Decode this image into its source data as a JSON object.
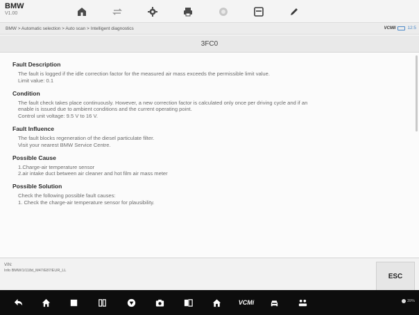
{
  "app": {
    "brand": "BMW",
    "version": "V1.00"
  },
  "toolbar": {
    "icons": [
      "home-icon",
      "vehicle-swap-icon",
      "settings-icon",
      "print-icon",
      "help-icon",
      "save-icon",
      "edit-icon"
    ]
  },
  "breadcrumb": {
    "path": "BMW > Automatic selection > Auto scan > Intelligent diagnostics",
    "vcm_label": "VCMII",
    "time": "12:5"
  },
  "dtc": {
    "code": "3FC0"
  },
  "sections": [
    {
      "heading": "Fault Description",
      "lines": [
        "The fault is logged if the idle correction factor for the measured air mass exceeds the permissible limit value.",
        "Limit value: 0.1"
      ]
    },
    {
      "heading": "Condition",
      "lines": [
        "The fault check takes place continuously. However, a new correction factor is calculated only once per driving cycle and if an",
        "enable is issued due to ambient conditions and the current operating point.",
        "Control unit voltage: 9.5 V to 16 V."
      ]
    },
    {
      "heading": "Fault Influence",
      "lines": [
        "The fault blocks regeneration of the diesel particulate filter.",
        "Visit your nearest BMW Service Centre."
      ]
    },
    {
      "heading": "Possible Cause",
      "lines": [
        "1.Charge-air temperature sensor",
        "2.air intake duct between air cleaner and hot film air mass meter"
      ]
    },
    {
      "heading": "Possible Solution",
      "lines": [
        "Check the following possible fault causes:",
        "1. Check the charge-air temperature sensor for plausibility."
      ]
    }
  ],
  "footer": {
    "vin_label": "VIN:",
    "vehicle_path": "Info BMW/1/118d_M47/E87/EUR_LL",
    "esc_label": "ESC"
  },
  "navbar": {
    "icons": [
      "back-icon",
      "home-icon",
      "recent-apps-icon",
      "split-screen-icon",
      "browser-icon",
      "camera-icon",
      "screen-record-icon",
      "maxifix-home-icon",
      "vcm-icon",
      "vehicle-icon",
      "network-icon"
    ],
    "vcm_text": "VCMi",
    "status_text": "39%"
  }
}
